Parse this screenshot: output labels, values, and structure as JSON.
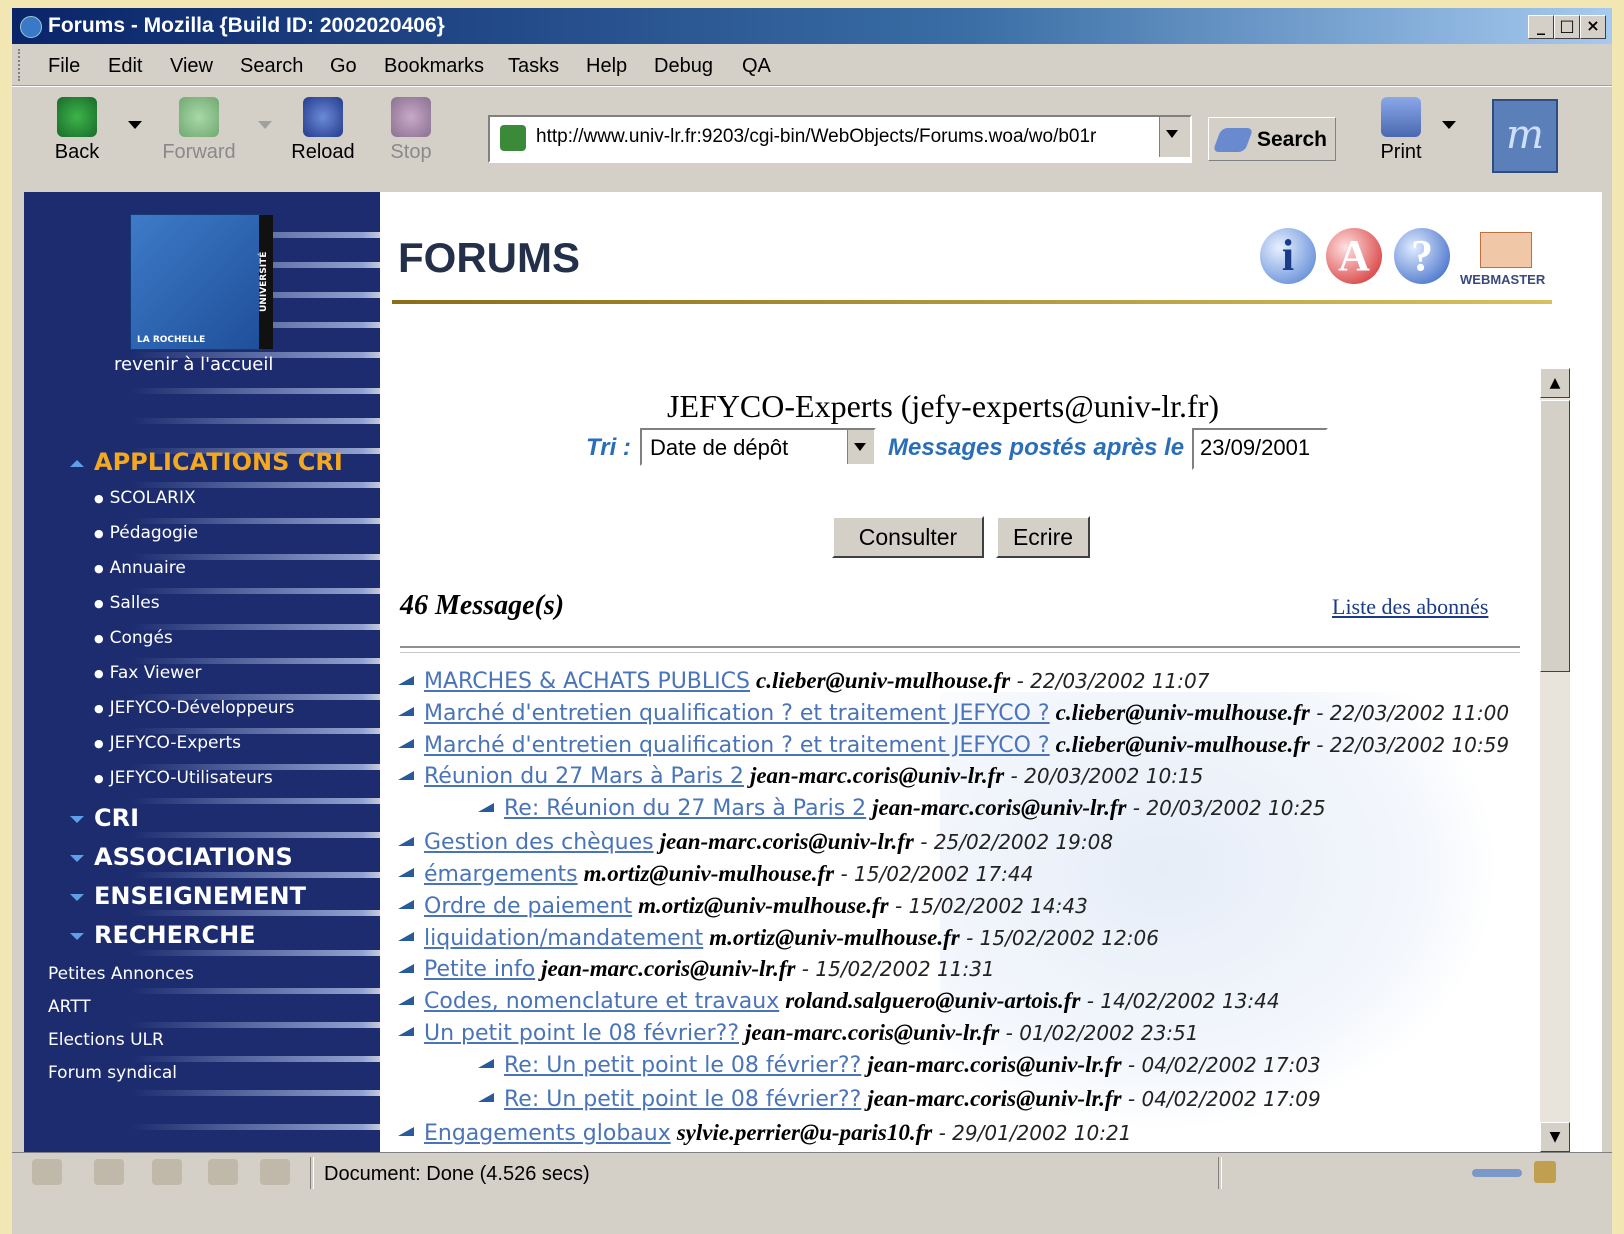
{
  "window": {
    "title": "Forums - Mozilla {Build ID: 2002020406}",
    "min": "_",
    "max": "□",
    "close": "×"
  },
  "menu": [
    "File",
    "Edit",
    "View",
    "Search",
    "Go",
    "Bookmarks",
    "Tasks",
    "Help",
    "Debug",
    "QA"
  ],
  "toolbar": {
    "back": "Back",
    "forward": "Forward",
    "reload": "Reload",
    "stop": "Stop",
    "print": "Print",
    "url": "http://www.univ-lr.fr:9203/cgi-bin/WebObjects/Forums.woa/wo/b01r",
    "search": "Search",
    "throbber": "m"
  },
  "sidebar": {
    "logo_text": "UNIVERSITÉ",
    "logo_seal": "LA ROCHELLE",
    "home": "revenir à l'accueil",
    "section_open": "APPLICATIONS CRI",
    "subitems": [
      "SCOLARIX",
      "Pédagogie",
      "Annuaire",
      "Salles",
      "Congés",
      "Fax Viewer",
      "JEFYCO-Développeurs",
      "JEFYCO-Experts",
      "JEFYCO-Utilisateurs"
    ],
    "sections": [
      "CRI",
      "ASSOCIATIONS",
      "ENSEIGNEMENT",
      "RECHERCHE"
    ],
    "links": [
      "Petites Annonces",
      "ARTT",
      "Elections ULR",
      "Forum syndical"
    ]
  },
  "header": {
    "title": "FORUMS",
    "icon_info": "i",
    "icon_a": "A",
    "icon_help": "?",
    "webmaster": "WEBMASTER"
  },
  "forum": {
    "name": "JEFYCO-Experts   (jefy-experts@univ-lr.fr)",
    "sort_label": "Tri :",
    "sort_value": "Date de dépôt",
    "after_label": "Messages postés après le :",
    "after_value": "23/09/2001",
    "consult": "Consulter",
    "write": "Ecrire",
    "count": "46 Message(s)",
    "subscribers": "Liste des abonnés"
  },
  "messages": [
    {
      "subject": "MARCHES & ACHATS PUBLICS",
      "author": "c.lieber@univ-mulhouse.fr",
      "date": " - 22/03/2002 11:07",
      "reply": false
    },
    {
      "subject": "Marché d'entretien qualification ? et traitement JEFYCO ?",
      "author": "c.lieber@univ-mulhouse.fr",
      "date": " - 22/03/2002 11:00",
      "reply": false
    },
    {
      "subject": "Marché d'entretien qualification ? et traitement JEFYCO ?",
      "author": "c.lieber@univ-mulhouse.fr",
      "date": " - 22/03/2002 10:59",
      "reply": false
    },
    {
      "subject": "Réunion du 27 Mars à Paris 2",
      "author": "jean-marc.coris@univ-lr.fr",
      "date": " - 20/03/2002 10:15",
      "reply": false
    },
    {
      "subject": "Re: Réunion du 27 Mars à Paris 2",
      "author": "jean-marc.coris@univ-lr.fr",
      "date": " - 20/03/2002 10:25",
      "reply": true
    },
    {
      "subject": "Gestion des chèques",
      "author": "jean-marc.coris@univ-lr.fr",
      "date": " - 25/02/2002 19:08",
      "reply": false
    },
    {
      "subject": "émargements",
      "author": "m.ortiz@univ-mulhouse.fr",
      "date": " - 15/02/2002 17:44",
      "reply": false
    },
    {
      "subject": "Ordre de paiement",
      "author": "m.ortiz@univ-mulhouse.fr",
      "date": " - 15/02/2002 14:43",
      "reply": false
    },
    {
      "subject": "liquidation/mandatement",
      "author": "m.ortiz@univ-mulhouse.fr",
      "date": " - 15/02/2002 12:06",
      "reply": false
    },
    {
      "subject": "Petite info",
      "author": "jean-marc.coris@univ-lr.fr",
      "date": " - 15/02/2002 11:31",
      "reply": false
    },
    {
      "subject": "Codes, nomenclature et travaux",
      "author": "roland.salguero@univ-artois.fr",
      "date": " - 14/02/2002 13:44",
      "reply": false
    },
    {
      "subject": "Un petit point le 08 février??",
      "author": "jean-marc.coris@univ-lr.fr",
      "date": " - 01/02/2002 23:51",
      "reply": false
    },
    {
      "subject": "Re: Un petit point le 08 février??",
      "author": "jean-marc.coris@univ-lr.fr",
      "date": " - 04/02/2002 17:03",
      "reply": true
    },
    {
      "subject": "Re: Un petit point le 08 février??",
      "author": "jean-marc.coris@univ-lr.fr",
      "date": " - 04/02/2002 17:09",
      "reply": true
    },
    {
      "subject": "Engagements globaux",
      "author": "sylvie.perrier@u-paris10.fr",
      "date": " - 29/01/2002 10:21",
      "reply": false
    }
  ],
  "status": {
    "text": "Document: Done (4.526 secs)"
  },
  "colors": {
    "sidebar": "#1c2c6e",
    "accent": "#f4a820",
    "link": "#4a74b8",
    "label_blue": "#2a6eb8"
  }
}
